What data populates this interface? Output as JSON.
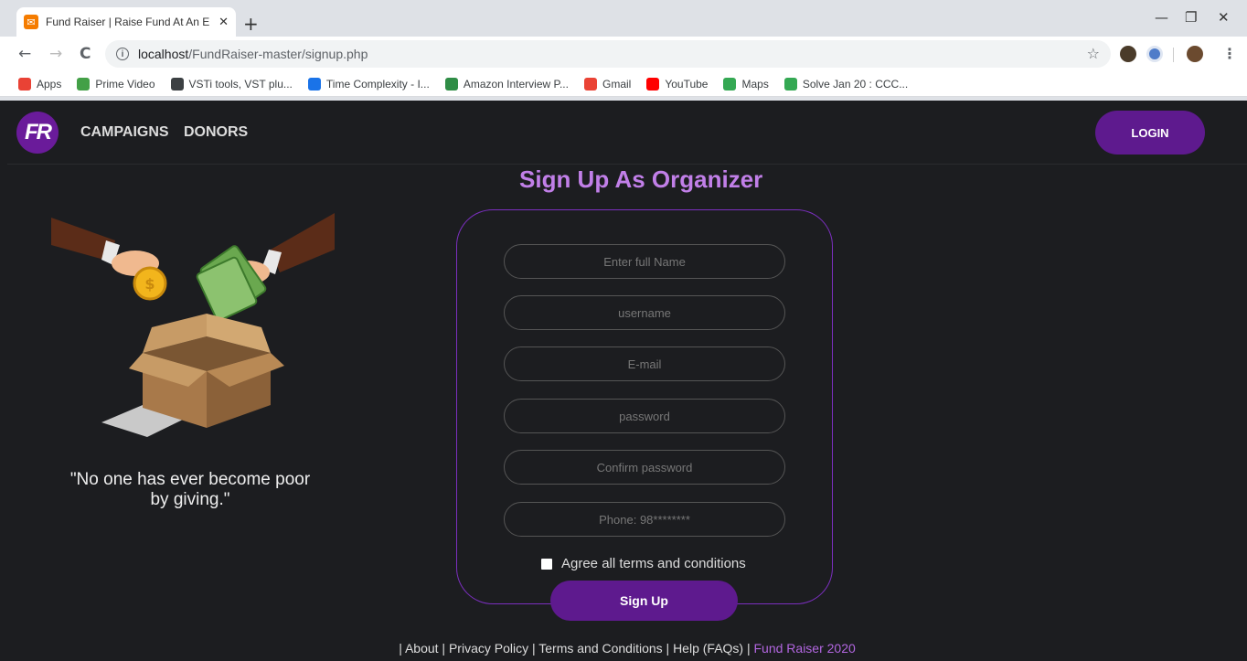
{
  "browser": {
    "tab_title": "Fund Raiser | Raise Fund At An E",
    "tab_close": "✕",
    "new_tab": "+",
    "minimize": "—",
    "maximize": "❐",
    "close": "✕",
    "back": "←",
    "forward": "→",
    "reload": "C",
    "url_host": "localhost",
    "url_path": "/FundRaiser-master/signup.php",
    "bookmarks": [
      {
        "label": "Apps",
        "icon": "apps-grid-icon",
        "color": "#e94235"
      },
      {
        "label": "Prime Video",
        "icon": "prime-video-icon",
        "color": "#43a047"
      },
      {
        "label": "VSTi tools, VST plu...",
        "icon": "vsti-icon",
        "color": "#3c4043"
      },
      {
        "label": "Time Complexity - I...",
        "icon": "interviewbit-icon",
        "color": "#1a73e8"
      },
      {
        "label": "Amazon Interview P...",
        "icon": "geeksforgeeks-icon",
        "color": "#2f8d46"
      },
      {
        "label": "Gmail",
        "icon": "gmail-icon",
        "color": "#ea4335"
      },
      {
        "label": "YouTube",
        "icon": "youtube-icon",
        "color": "#ff0000"
      },
      {
        "label": "Maps",
        "icon": "maps-icon",
        "color": "#34a853"
      },
      {
        "label": "Solve Jan 20 : CCC...",
        "icon": "codechef-icon",
        "color": "#34a853"
      }
    ]
  },
  "nav": {
    "logo": "FR",
    "links": [
      "CAMPAIGNS",
      "DONORS"
    ],
    "login": "LOGIN"
  },
  "signup": {
    "title": "Sign Up As Organizer",
    "fields": [
      {
        "placeholder": "Enter full Name"
      },
      {
        "placeholder": "username"
      },
      {
        "placeholder": "E-mail"
      },
      {
        "placeholder": "password"
      },
      {
        "placeholder": "Confirm password"
      },
      {
        "placeholder": "Phone: 98********"
      }
    ],
    "terms_label": "Agree all terms and conditions",
    "button": "Sign Up"
  },
  "quote": "\"No one has ever become poor by giving.\"",
  "footer": {
    "links": "| About | Privacy Policy | Terms and Conditions | Help (FAQs) | ",
    "brand": "Fund Raiser 2020"
  },
  "colors": {
    "accent": "#5e1a8e",
    "title": "#c17fe8",
    "background": "#1c1d20"
  }
}
